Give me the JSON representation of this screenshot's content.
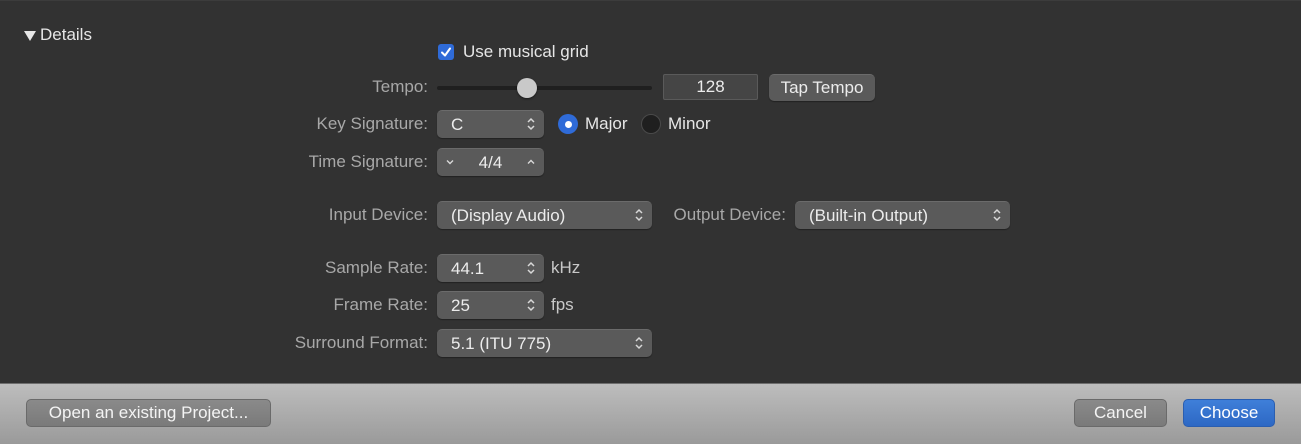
{
  "details": {
    "header": "Details",
    "use_musical_grid": {
      "label": "Use musical grid",
      "checked": true
    },
    "tempo": {
      "label": "Tempo:",
      "value": "128",
      "slider_fraction": 0.42,
      "tap_tempo": "Tap Tempo"
    },
    "key_signature": {
      "label": "Key Signature:",
      "value": "C",
      "major": "Major",
      "minor": "Minor",
      "selected": "Major"
    },
    "time_signature": {
      "label": "Time Signature:",
      "value": "4/4"
    },
    "input_device": {
      "label": "Input Device:",
      "value": "(Display Audio)"
    },
    "output_device": {
      "label": "Output Device:",
      "value": "(Built-in Output)"
    },
    "sample_rate": {
      "label": "Sample Rate:",
      "value": "44.1",
      "unit": "kHz"
    },
    "frame_rate": {
      "label": "Frame Rate:",
      "value": "25",
      "unit": "fps"
    },
    "surround_format": {
      "label": "Surround Format:",
      "value": "5.1 (ITU 775)"
    }
  },
  "footer": {
    "open_existing": "Open an existing Project...",
    "cancel": "Cancel",
    "choose": "Choose"
  },
  "colors": {
    "accent": "#2f6bd8",
    "panel": "#323232"
  }
}
